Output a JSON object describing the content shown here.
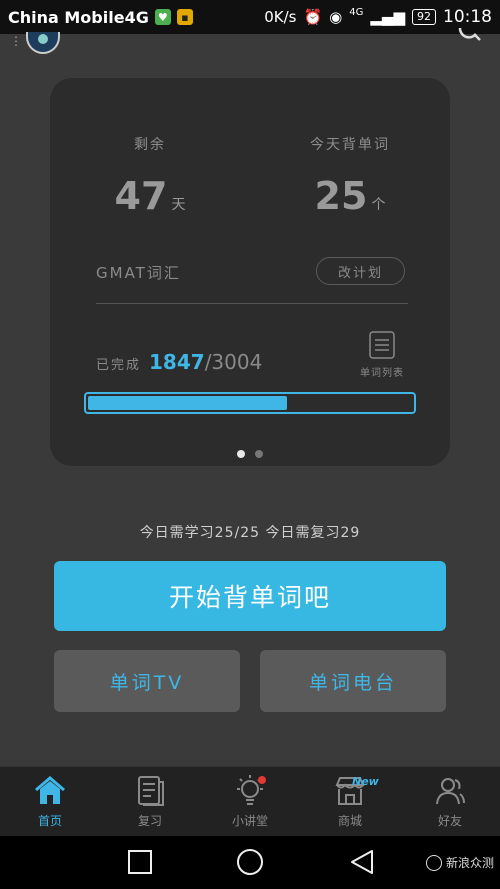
{
  "status_bar": {
    "carrier": "China Mobile4G",
    "net_speed": "0K/s",
    "net_type": "4G",
    "battery": "92",
    "time": "10:18"
  },
  "plan_card": {
    "remaining_label": "剩余",
    "remaining_value": "47",
    "remaining_unit": "天",
    "today_words_label": "今天背单词",
    "today_words_value": "25",
    "today_words_unit": "个",
    "exam_label": "GMAT词汇",
    "change_plan_label": "改计划",
    "completed_label": "已完成",
    "completed_count": "1847",
    "total_words": "/3004",
    "word_list_label": "单词列表",
    "progress": 0.6149,
    "pager": {
      "count": 2,
      "active": 0
    }
  },
  "today_info": "今日需学习25/25 今日需复习29",
  "actions": {
    "start_label": "开始背单词吧",
    "word_tv_label": "单词TV",
    "word_radio_label": "单词电台"
  },
  "tabs": [
    {
      "label": "首页",
      "icon": "home-icon",
      "active": true
    },
    {
      "label": "复习",
      "icon": "review-icon",
      "active": false
    },
    {
      "label": "小讲堂",
      "icon": "lightbulb-icon",
      "active": false
    },
    {
      "label": "商城",
      "icon": "store-icon",
      "active": false,
      "badge": "New"
    },
    {
      "label": "好友",
      "icon": "friends-icon",
      "active": false
    }
  ],
  "watermark": "新浪众测",
  "colors": {
    "accent": "#36b8e3",
    "background": "#3a3a3a",
    "card": "#2c2c2c",
    "notification": "#e53935"
  }
}
